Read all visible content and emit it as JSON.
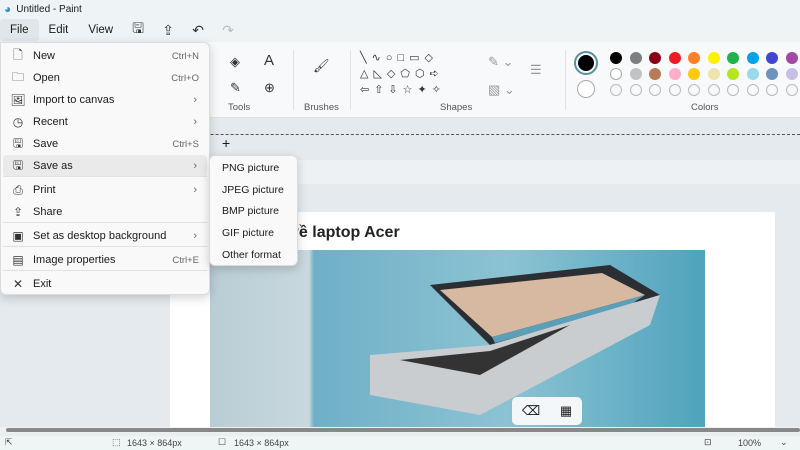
{
  "title": "Untitled - Paint",
  "menu": {
    "file": "File",
    "edit": "Edit",
    "view": "View"
  },
  "ribbon": {
    "tools_label": "Tools",
    "brushes_label": "Brushes",
    "shapes_label": "Shapes",
    "colors_label": "Colors",
    "colors_row1": [
      "#000000",
      "#7f7f7f",
      "#880015",
      "#ed1c24",
      "#ff7f27",
      "#fff200",
      "#22b14c",
      "#00a2e8",
      "#3f48cc",
      "#a349a4"
    ],
    "colors_row2": [
      "#ffffff",
      "#c3c3c3",
      "#b97a57",
      "#ffaec9",
      "#ffc90e",
      "#efe4b0",
      "#b5e61d",
      "#99d9ea",
      "#7092be",
      "#c8bfe7"
    ],
    "primary_color": "#000000",
    "secondary_color": "#ffffff"
  },
  "file_menu": [
    {
      "icon": "new-file-icon",
      "glyph": "🗋",
      "label": "New",
      "shortcut": "Ctrl+N"
    },
    {
      "icon": "open-folder-icon",
      "glyph": "🗀",
      "label": "Open",
      "shortcut": "Ctrl+O"
    },
    {
      "icon": "import-icon",
      "glyph": "🖼",
      "label": "Import to canvas",
      "shortcut": "›"
    },
    {
      "icon": "recent-clock-icon",
      "glyph": "◷",
      "label": "Recent",
      "shortcut": "›"
    },
    {
      "icon": "save-icon",
      "glyph": "🖫",
      "label": "Save",
      "shortcut": "Ctrl+S"
    },
    {
      "icon": "save-as-icon",
      "glyph": "🖫",
      "label": "Save as",
      "shortcut": "›"
    },
    {
      "icon": "print-icon",
      "glyph": "⎙",
      "label": "Print",
      "shortcut": "›"
    },
    {
      "icon": "share-icon",
      "glyph": "⇪",
      "label": "Share",
      "shortcut": ""
    },
    {
      "icon": "desktop-background-icon",
      "glyph": "▣",
      "label": "Set as desktop background",
      "shortcut": "›"
    },
    {
      "icon": "image-properties-icon",
      "glyph": "▤",
      "label": "Image properties",
      "shortcut": "Ctrl+E"
    },
    {
      "icon": "exit-icon",
      "glyph": "✕",
      "label": "Exit",
      "shortcut": ""
    }
  ],
  "save_as_menu": [
    "PNG picture",
    "JPEG picture",
    "BMP picture",
    "GIF picture",
    "Other format"
  ],
  "canvas": {
    "heading": "về laptop Acer",
    "add_tab": "+"
  },
  "status": {
    "selection_size": "1643 × 864px",
    "canvas_size": "1643 × 864px",
    "zoom": "100%"
  }
}
